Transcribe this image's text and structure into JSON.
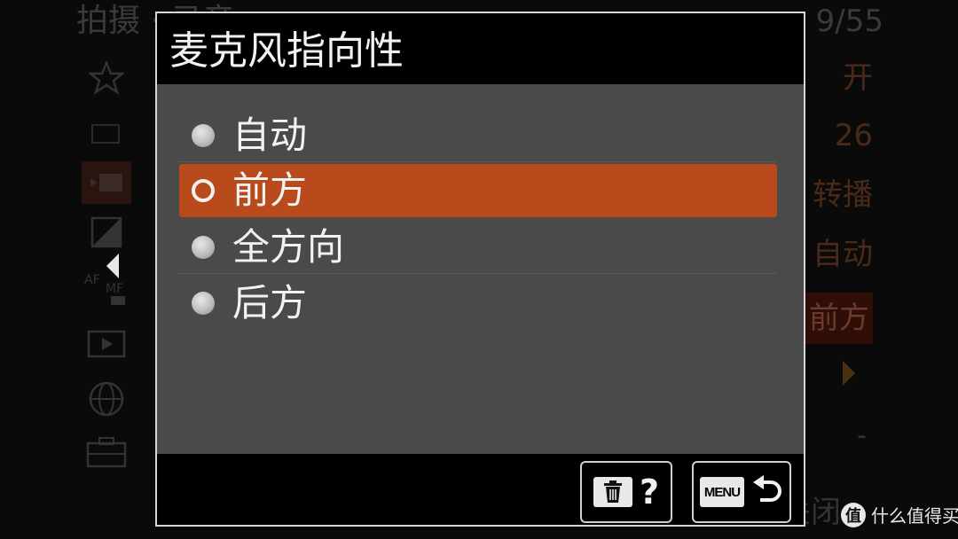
{
  "background_menu": {
    "title": "拍摄 · 录音",
    "page_indicator": "9/55",
    "right_values": [
      "开",
      "26",
      "转播",
      "自动",
      "前方"
    ],
    "active_value_index": 4,
    "dash": "-",
    "close_label": "关闭"
  },
  "dialog": {
    "title": "麦克风指向性",
    "options": [
      {
        "label": "自动",
        "selected": false
      },
      {
        "label": "前方",
        "selected": true
      },
      {
        "label": "全方向",
        "selected": false
      },
      {
        "label": "后方",
        "selected": false
      }
    ],
    "help_button": {
      "symbol": "?"
    },
    "back_button": {
      "menu_label": "MENU"
    }
  },
  "watermark": {
    "logo": "值",
    "text": "什么值得买"
  },
  "colors": {
    "selection": "#b84a1c",
    "panel": "#4a4a4a",
    "frame": "#d6d6d6"
  }
}
